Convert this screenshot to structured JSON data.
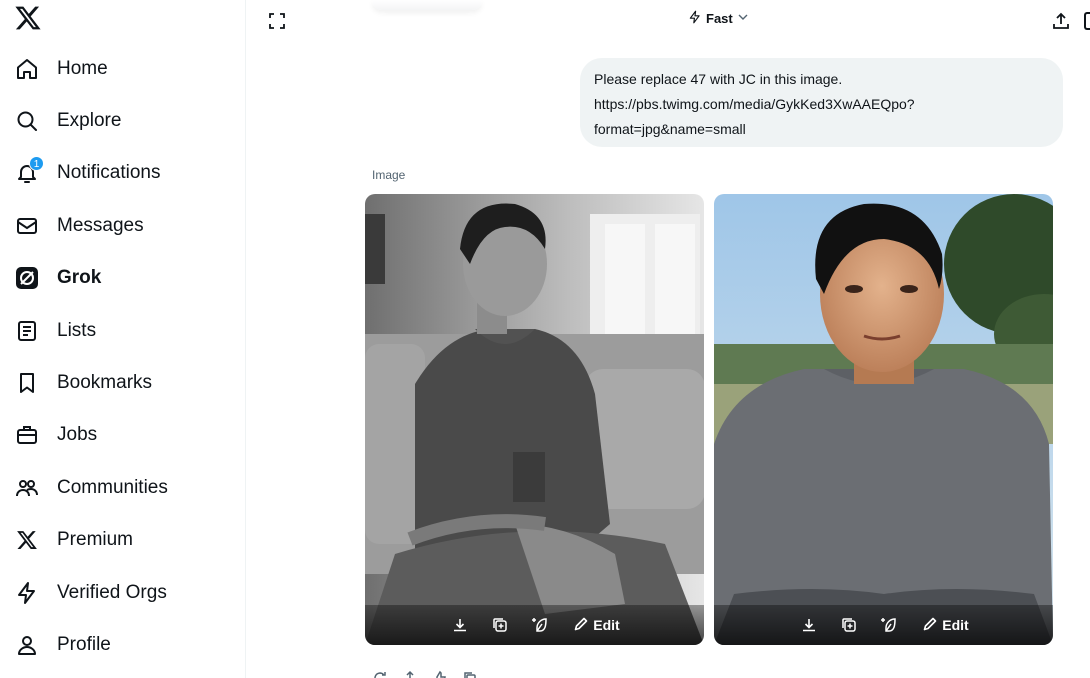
{
  "sidebar": {
    "logo": "x-logo-icon",
    "items": [
      {
        "label": "Home",
        "icon": "home-icon"
      },
      {
        "label": "Explore",
        "icon": "search-icon"
      },
      {
        "label": "Notifications",
        "icon": "bell-icon",
        "badge": "1"
      },
      {
        "label": "Messages",
        "icon": "mail-icon"
      },
      {
        "label": "Grok",
        "icon": "grok-icon",
        "active": true
      },
      {
        "label": "Lists",
        "icon": "list-icon"
      },
      {
        "label": "Bookmarks",
        "icon": "bookmark-icon"
      },
      {
        "label": "Jobs",
        "icon": "briefcase-icon"
      },
      {
        "label": "Communities",
        "icon": "people-icon"
      },
      {
        "label": "Premium",
        "icon": "x-logo-icon"
      },
      {
        "label": "Verified Orgs",
        "icon": "lightning-icon"
      },
      {
        "label": "Profile",
        "icon": "person-icon"
      }
    ]
  },
  "header": {
    "model_label": "Fast"
  },
  "conversation": {
    "user_message_lines": [
      "Please replace 47 with JC in this image.",
      "https://pbs.twimg.com/media/GykKed3XwAAEQpo?",
      "format=jpg&name=small"
    ],
    "image_section_label": "Image",
    "image_actions": {
      "edit_label": "Edit"
    }
  },
  "colors": {
    "accent": "#1d9bf0",
    "bubble_bg": "#eff3f4",
    "text": "#0f1419",
    "muted": "#536471"
  }
}
